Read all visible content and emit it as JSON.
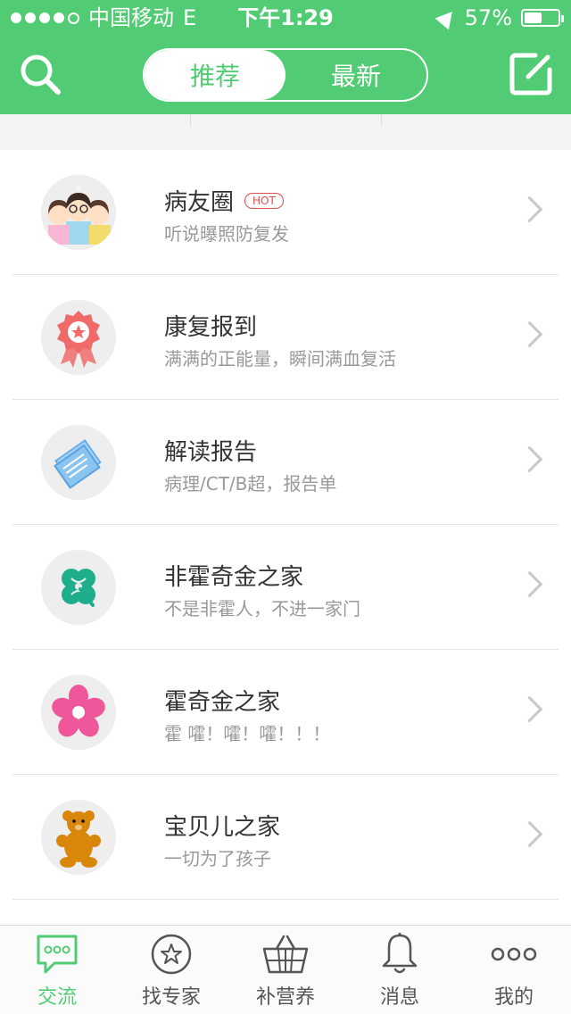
{
  "status_bar": {
    "carrier": "中国移动",
    "network": "E",
    "time": "下午1:29",
    "battery": "57%",
    "battery_level": 0.57,
    "signal_dots_filled": 4,
    "signal_dots_total": 5
  },
  "header": {
    "segments": [
      {
        "label": "推荐",
        "active": true
      },
      {
        "label": "最新",
        "active": false
      }
    ],
    "search_icon": "search-icon",
    "compose_icon": "edit-icon",
    "accent": "#52cc74"
  },
  "list": [
    {
      "title": "病友圈",
      "badge": "HOT",
      "subtitle": "听说曝照防复发",
      "icon": "patient-group-icon"
    },
    {
      "title": "康复报到",
      "badge": "",
      "subtitle": "满满的正能量，瞬间满血复活",
      "icon": "medal-icon"
    },
    {
      "title": "解读报告",
      "badge": "",
      "subtitle": "病理/CT/B超，报告单",
      "icon": "report-icon"
    },
    {
      "title": "非霍奇金之家",
      "badge": "",
      "subtitle": "不是非霍人，不进一家门",
      "icon": "clover-icon"
    },
    {
      "title": "霍奇金之家",
      "badge": "",
      "subtitle": "霍 嚯！嚯！嚯！！！",
      "icon": "flower-icon"
    },
    {
      "title": "宝贝儿之家",
      "badge": "",
      "subtitle": "一切为了孩子",
      "icon": "bear-icon"
    }
  ],
  "tabbar": [
    {
      "label": "交流",
      "icon": "chat-icon",
      "active": true
    },
    {
      "label": "找专家",
      "icon": "star-icon",
      "active": false
    },
    {
      "label": "补营养",
      "icon": "basket-icon",
      "active": false
    },
    {
      "label": "消息",
      "icon": "bell-icon",
      "active": false
    },
    {
      "label": "我的",
      "icon": "more-icon",
      "active": false
    }
  ]
}
